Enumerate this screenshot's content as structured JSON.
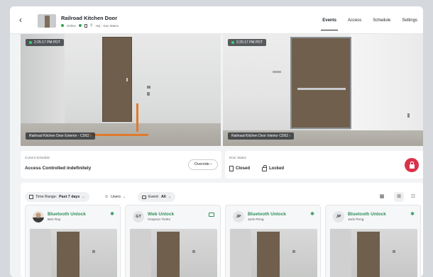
{
  "header": {
    "title": "Railroad Kitchen Door",
    "status": "Online",
    "location": "HQ - San Mateo",
    "tabs": [
      "Events",
      "Access",
      "Schedule",
      "Settings"
    ],
    "active_tab": "Events"
  },
  "cameras": [
    {
      "timestamp": "2:25:17 PM PDT",
      "label": "Railroad Kitchen Door Exterior - CD62"
    },
    {
      "timestamp": "2:25:17 PM PDT",
      "label": "Railroad Kitchen Door Interior CD62"
    }
  ],
  "schedule": {
    "caption": "Current Schedule",
    "value": "Access Controlled indefinitely",
    "override_label": "Override"
  },
  "door_status": {
    "caption": "Door Status",
    "position": "Closed",
    "lock": "Locked"
  },
  "filters": {
    "time_range_label": "Time Range:",
    "time_range_value": "Past 7 days",
    "users_label": "Users",
    "event_label": "Event:",
    "event_value": "All"
  },
  "events": [
    {
      "type": "Bluetooth Unlock",
      "user": "Ben Roy",
      "avatar": "",
      "icon": "bluetooth-icon"
    },
    {
      "type": "Web Unlock",
      "user": "Grayson Tonks",
      "avatar": "GT",
      "icon": "monitor-icon"
    },
    {
      "type": "Bluetooth Unlock",
      "user": "Jack Peng",
      "avatar": "JP",
      "icon": "bluetooth-icon"
    },
    {
      "type": "Bluetooth Unlock",
      "user": "Jack Peng",
      "avatar": "JP",
      "icon": "bluetooth-icon"
    }
  ],
  "colors": {
    "accent_green": "#2e8f5a",
    "lock_red": "#d9324a",
    "online": "#2ea44f"
  }
}
